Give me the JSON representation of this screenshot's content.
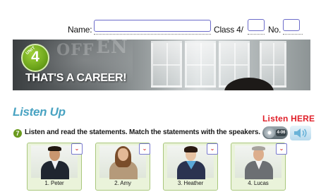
{
  "form": {
    "name_label": "Name:",
    "name_value": "",
    "class_label": "Class 4/",
    "class_value": "",
    "no_label": "No.",
    "no_value": ""
  },
  "banner": {
    "unit_word": "UNIT",
    "unit_number": "4",
    "title": "THAT'S A CAREER!"
  },
  "section": {
    "title": "Listen Up",
    "listen_link": "Listen HERE"
  },
  "exercise": {
    "number": "7",
    "instruction": "Listen and read the statements. Match the statements with the speakers.",
    "track": "4-06"
  },
  "speakers": [
    {
      "label": "1. Peter"
    },
    {
      "label": "2. Amy"
    },
    {
      "label": "3. Heather"
    },
    {
      "label": "4. Lucas"
    }
  ],
  "icons": {
    "cd": "cd-icon",
    "speaker": "speaker-icon",
    "dropdown": "chevron-down-icon"
  },
  "colors": {
    "section_title": "#49a3c2",
    "listen_link": "#e0202a",
    "unit_badge": "#6da51b",
    "field_border": "#6b6bc9",
    "card_bg": "#eaf3da"
  }
}
